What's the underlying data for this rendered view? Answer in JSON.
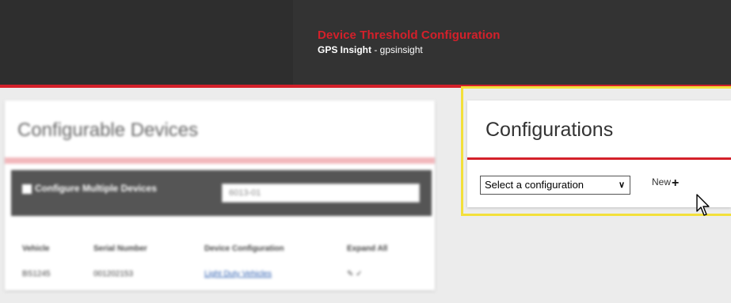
{
  "header": {
    "title": "Device Threshold Configuration",
    "subtitle_brand": "GPS Insight",
    "subtitle_rest": " - gpsinsight",
    "accent_color": "#d4202a"
  },
  "left_panel": {
    "title": "Configurable Devices",
    "filter": {
      "checkbox_label": "Configure Multiple Devices",
      "search_value": "6013-01"
    },
    "table": {
      "columns": [
        "Vehicle",
        "Serial Number",
        "Device Configuration",
        "Expand All"
      ],
      "rows": [
        {
          "vehicle": "BS1245",
          "serial": "001202153",
          "configuration": "Light Duty Vehicles",
          "expand": "✎ ✓"
        }
      ]
    }
  },
  "right_panel": {
    "title": "Configurations",
    "select_value": "Select a configuration",
    "new_label": "New",
    "new_icon": "plus-icon",
    "highlight_color": "#f3e03b"
  }
}
